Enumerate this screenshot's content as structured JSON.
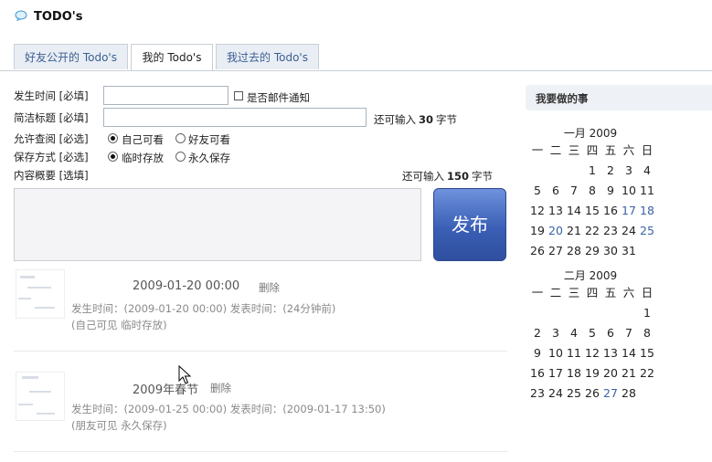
{
  "header": {
    "title": "TODO's"
  },
  "tabs": [
    {
      "label": "好友公开的 Todo's",
      "active": false
    },
    {
      "label": "我的 Todo's",
      "active": true
    },
    {
      "label": "我过去的 Todo's",
      "active": false
    }
  ],
  "form": {
    "time_label": "发生时间 [必填]",
    "email_notify_label": "是否邮件通知",
    "title_label": "简洁标题 [必填]",
    "title_remaining_pre": "还可输入",
    "title_remaining_num": "30",
    "title_remaining_post": "字节",
    "visibility_label": "允许查阅 [必选]",
    "visibility_self": "自己可看",
    "visibility_friends": "好友可看",
    "storage_label": "保存方式 [必选]",
    "storage_temp": "临时存放",
    "storage_forever": "永久保存",
    "content_label": "内容概要 [选填]",
    "content_remaining_pre": "还可输入",
    "content_remaining_num": "150",
    "content_remaining_post": "字节",
    "publish_label": "发布"
  },
  "entries": [
    {
      "title": "2009-01-20 00:00",
      "delete": "删除",
      "meta1": "发生时间：(2009-01-20 00:00) 发表时间：(24分钟前)",
      "meta2": "(自己可见 临时存放)"
    },
    {
      "title": "2009年春节",
      "delete": "删除",
      "meta1": "发生时间：(2009-01-25 00:00) 发表时间：(2009-01-17 13:50)",
      "meta2": "(朋友可见 永久保存)"
    }
  ],
  "sidebar": {
    "title": "我要做的事",
    "weekdays": [
      "一",
      "二",
      "三",
      "四",
      "五",
      "六",
      "日"
    ],
    "calendars": [
      {
        "month": "一月 2009",
        "days": [
          "",
          "",
          "",
          "1",
          "2",
          "3",
          "4",
          "5",
          "6",
          "7",
          "8",
          "9",
          "10",
          "11",
          "12",
          "13",
          "14",
          "15",
          "16",
          "17",
          "18",
          "19",
          "20",
          "21",
          "22",
          "23",
          "24",
          "25",
          "26",
          "27",
          "28",
          "29",
          "30",
          "31"
        ],
        "linked": [
          "17",
          "18",
          "20",
          "25"
        ]
      },
      {
        "month": "二月 2009",
        "days": [
          "",
          "",
          "",
          "",
          "",
          "",
          "1",
          "2",
          "3",
          "4",
          "5",
          "6",
          "7",
          "8",
          "9",
          "10",
          "11",
          "12",
          "13",
          "14",
          "15",
          "16",
          "17",
          "18",
          "19",
          "20",
          "21",
          "22",
          "23",
          "24",
          "25",
          "26",
          "27",
          "28"
        ],
        "linked": [
          "27"
        ]
      }
    ]
  },
  "colors": {
    "link": "#3b62a8",
    "button": "#3a5fb6",
    "tab_bg": "#e9eef5"
  },
  "icons": {
    "header": "speech-bubble-icon"
  }
}
